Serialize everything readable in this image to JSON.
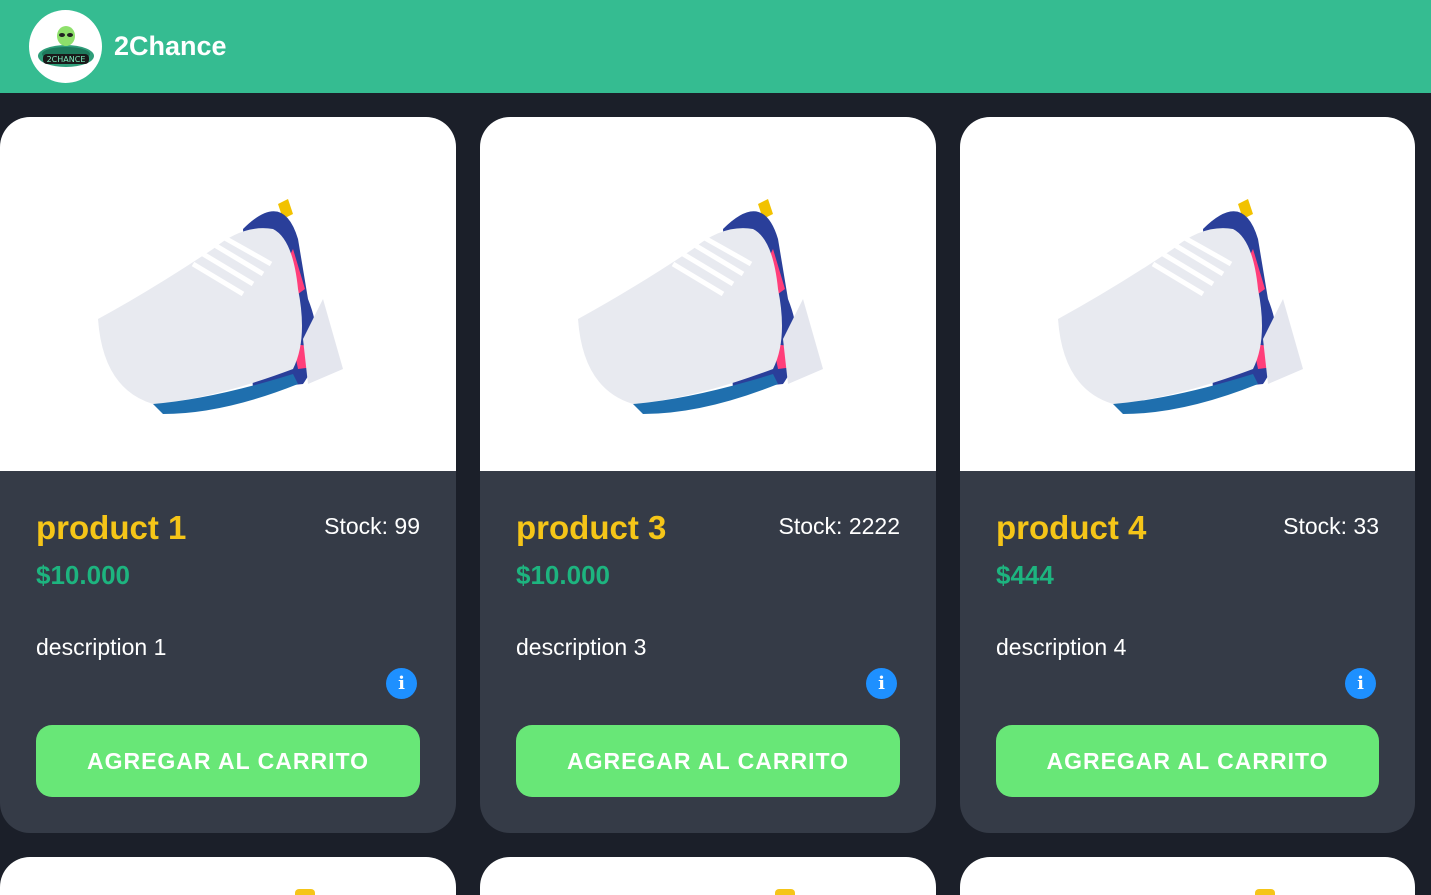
{
  "navbar": {
    "brand": "2Chance",
    "logo_text": "2CHANCE"
  },
  "products": [
    {
      "name": "product 1",
      "stock": "Stock: 99",
      "price": "$10.000",
      "description": "description 1",
      "button": "AGREGAR AL CARRITO"
    },
    {
      "name": "product 3",
      "stock": "Stock: 2222",
      "price": "$10.000",
      "description": "description 3",
      "button": "AGREGAR AL CARRITO"
    },
    {
      "name": "product 4",
      "stock": "Stock: 33",
      "price": "$444",
      "description": "description 4",
      "button": "AGREGAR AL CARRITO"
    }
  ],
  "icons": {
    "info": "info-icon",
    "product_image": "sneaker-icon"
  },
  "colors": {
    "navbar": "#35bc91",
    "background": "#1b1f29",
    "card": "#353b47",
    "title": "#f5c518",
    "price": "#1db47f",
    "button": "#68e777",
    "info": "#1e90ff"
  }
}
